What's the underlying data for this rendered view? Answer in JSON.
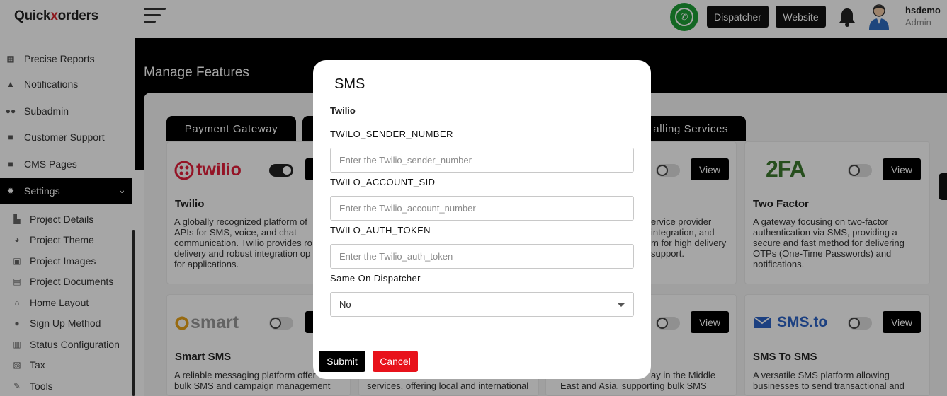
{
  "app": {
    "logo_text_a": "Quick",
    "logo_text_x": "x",
    "logo_text_b": "orders",
    "logo_cross": "✕"
  },
  "sidebar": {
    "items": [
      {
        "label": "Precise Reports",
        "icon": "report-icon"
      },
      {
        "label": "Notifications",
        "icon": "bell-icon"
      },
      {
        "label": "Subadmin",
        "icon": "users-icon"
      },
      {
        "label": "Customer Support",
        "icon": "chat-icon"
      },
      {
        "label": "CMS Pages",
        "icon": "pages-icon"
      },
      {
        "label": "Settings",
        "icon": "gear-icon",
        "active": true
      }
    ],
    "sub_items": [
      {
        "label": "Project Details",
        "icon": "project-icon"
      },
      {
        "label": "Project Theme",
        "icon": "palette-icon"
      },
      {
        "label": "Project Images",
        "icon": "image-icon"
      },
      {
        "label": "Project Documents",
        "icon": "document-icon"
      },
      {
        "label": "Home Layout",
        "icon": "home-icon"
      },
      {
        "label": "Sign Up Method",
        "icon": "signup-icon"
      },
      {
        "label": "Status Configuration",
        "icon": "status-icon"
      },
      {
        "label": "Tax",
        "icon": "tax-icon"
      },
      {
        "label": "Tools",
        "icon": "tools-icon"
      }
    ]
  },
  "header": {
    "dispatcher_label": "Dispatcher",
    "website_label": "Website",
    "user_name": "hsdemo",
    "user_role": "Admin",
    "whatsapp_color": "#1e9e36"
  },
  "main": {
    "page_title": "Manage Features",
    "tabs": [
      {
        "label": "Payment Gateway"
      },
      {
        "label": "alling Services"
      }
    ],
    "cards": [
      {
        "title": "Twilio",
        "logo_text": "twilio",
        "toggle": "on",
        "desc": [
          "A globally recognized platform of",
          "APIs for SMS, voice, and chat",
          "communication. Twilio provides ro",
          "delivery and robust integration op",
          "for applications."
        ]
      },
      {
        "title": "",
        "toggle": "off",
        "view_label": "View",
        "desc": [
          "ervice provider",
          " integration, and",
          "m for high delivery",
          " support."
        ]
      },
      {
        "title": "Two Factor",
        "logo_text": "2FA",
        "toggle": "off",
        "view_label": "View",
        "desc": [
          "A gateway focusing on two-factor",
          "authentication via SMS, providing a",
          "secure and fast method for delivering",
          "OTPs (One-Time Passwords) and",
          "notifications."
        ]
      },
      {
        "title": "Smart SMS",
        "logo_text": "smart",
        "toggle": "off",
        "desc": [
          "A reliable messaging platform offer",
          "bulk SMS and campaign management"
        ]
      },
      {
        "title": "",
        "desc": [
          "services, offering local and international"
        ]
      },
      {
        "title": "",
        "toggle": "off",
        "view_label": "View",
        "desc": [
          "ay in the Middle",
          "East and Asia, supporting bulk SMS"
        ]
      },
      {
        "title": "SMS To SMS",
        "logo_text": "SMS.to",
        "toggle": "off",
        "view_label": "View",
        "desc": [
          "A versatile SMS platform allowing",
          "businesses to send transactional and"
        ]
      }
    ]
  },
  "modal": {
    "title": "SMS",
    "subtitle": "Twilio",
    "fields": [
      {
        "label": "TWILO_SENDER_NUMBER",
        "placeholder": "Enter the Twilio_sender_number"
      },
      {
        "label": "TWILO_ACCOUNT_SID",
        "placeholder": "Enter the Twilio_account_number"
      },
      {
        "label": "TWILO_AUTH_TOKEN",
        "placeholder": "Enter the Twilio_auth_token"
      }
    ],
    "select_label": "Same On Dispatcher",
    "select_value": "No",
    "submit_label": "Submit",
    "cancel_label": "Cancel",
    "submit_color": "#000000",
    "cancel_color": "#e8121b"
  }
}
